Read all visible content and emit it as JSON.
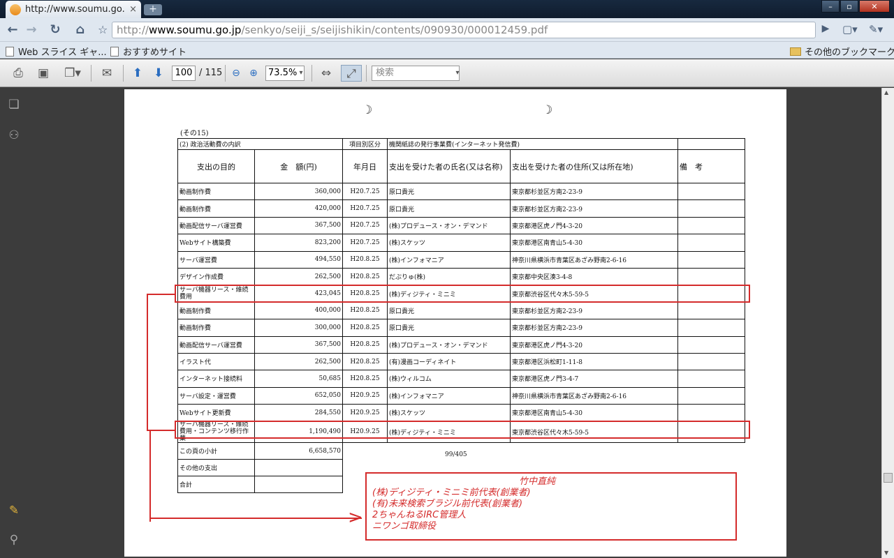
{
  "browser": {
    "tab_title": "http://www.soumu.go...",
    "tab_close": "×",
    "new_tab": "+",
    "url_prefix": "http://",
    "url_domain": "www.soumu.go.jp",
    "url_path": "/senkyo/seiji_s/seijishikin/contents/090930/000012459.pdf",
    "bookmarks": [
      {
        "label": "Web スライス ギャ..."
      },
      {
        "label": "おすすめサイト"
      }
    ],
    "other_bookmarks": "その他のブックマーク"
  },
  "pdf_toolbar": {
    "page_current": "100",
    "page_total": "/ 115",
    "zoom": "73.5%",
    "search_placeholder": "検索"
  },
  "document": {
    "section": "(その15)",
    "table_title": "(2) 政治活動費の内訳",
    "category_label": "項目別区分",
    "category_value": "機関紙誌の発行事業費(インターネット発信費)",
    "headers": [
      "支出の目的",
      "金　額(円)",
      "年月日",
      "支出を受けた者の氏名(又は名称)",
      "支出を受けた者の住所(又は所在地)",
      "備　考"
    ],
    "rows": [
      {
        "purpose": "動画制作費",
        "amount": "360,000",
        "date": "H20.7.25",
        "name": "原口貴光",
        "address": "東京都杉並区方南2-23-9"
      },
      {
        "purpose": "動画制作費",
        "amount": "420,000",
        "date": "H20.7.25",
        "name": "原口貴光",
        "address": "東京都杉並区方南2-23-9"
      },
      {
        "purpose": "動画配信サーバ運営費",
        "amount": "367,500",
        "date": "H20.7.25",
        "name": "(株)プロデュース・オン・デマンド",
        "address": "東京都港区虎ノ門4-3-20"
      },
      {
        "purpose": "Webサイト構築費",
        "amount": "823,200",
        "date": "H20.7.25",
        "name": "(株)スケッツ",
        "address": "東京都港区南青山5-4-30"
      },
      {
        "purpose": "サーバ運営費",
        "amount": "494,550",
        "date": "H20.8.25",
        "name": "(株)インフォマニア",
        "address": "神奈川県横浜市青葉区あざみ野南2-6-16"
      },
      {
        "purpose": "デザイン作成費",
        "amount": "262,500",
        "date": "H20.8.25",
        "name": "だぶりゅ(株)",
        "address": "東京都中央区湊3-4-8"
      },
      {
        "purpose": "サーバ機器リース・維続費用",
        "amount": "423,045",
        "date": "H20.8.25",
        "name": "(株)ディジティ・ミニミ",
        "address": "東京都渋谷区代々木5-59-5"
      },
      {
        "purpose": "動画制作費",
        "amount": "400,000",
        "date": "H20.8.25",
        "name": "原口貴光",
        "address": "東京都杉並区方南2-23-9"
      },
      {
        "purpose": "動画制作費",
        "amount": "300,000",
        "date": "H20.8.25",
        "name": "原口貴光",
        "address": "東京都杉並区方南2-23-9"
      },
      {
        "purpose": "動画配信サーバ運営費",
        "amount": "367,500",
        "date": "H20.8.25",
        "name": "(株)プロデュース・オン・デマンド",
        "address": "東京都港区虎ノ門4-3-20"
      },
      {
        "purpose": "イラスト代",
        "amount": "262,500",
        "date": "H20.8.25",
        "name": "(有)漫画コーディネイト",
        "address": "東京都港区浜松町1-11-8"
      },
      {
        "purpose": "インターネット接続料",
        "amount": "50,685",
        "date": "H20.8.25",
        "name": "(株)ウィルコム",
        "address": "東京都港区虎ノ門3-4-7"
      },
      {
        "purpose": "サーバ設定・運営費",
        "amount": "652,050",
        "date": "H20.9.25",
        "name": "(株)インフォマニア",
        "address": "神奈川県横浜市青葉区あざみ野南2-6-16"
      },
      {
        "purpose": "Webサイト更新費",
        "amount": "284,550",
        "date": "H20.9.25",
        "name": "(株)スケッツ",
        "address": "東京都港区南青山5-4-30"
      },
      {
        "purpose": "サーバ機器リース・維続費用・コンテンツ移行作業",
        "amount": "1,190,490",
        "date": "H20.9.25",
        "name": "(株)ディジティ・ミニミ",
        "address": "東京都渋谷区代々木5-59-5"
      }
    ],
    "subtotal_label": "この頁の小計",
    "subtotal_value": "6,658,570",
    "other_label": "その他の支出",
    "total_label": "合計",
    "page_no": "99/405"
  },
  "annotation": {
    "lines": [
      "竹中直純",
      "(株)ディジティ・ミニミ前代表(創業者)",
      "(有)未来検索ブラジル前代表(創業者)",
      "2ちゃんねるIRC管理人",
      "ニワンゴ取締役"
    ],
    "color": "#d42b2b"
  }
}
